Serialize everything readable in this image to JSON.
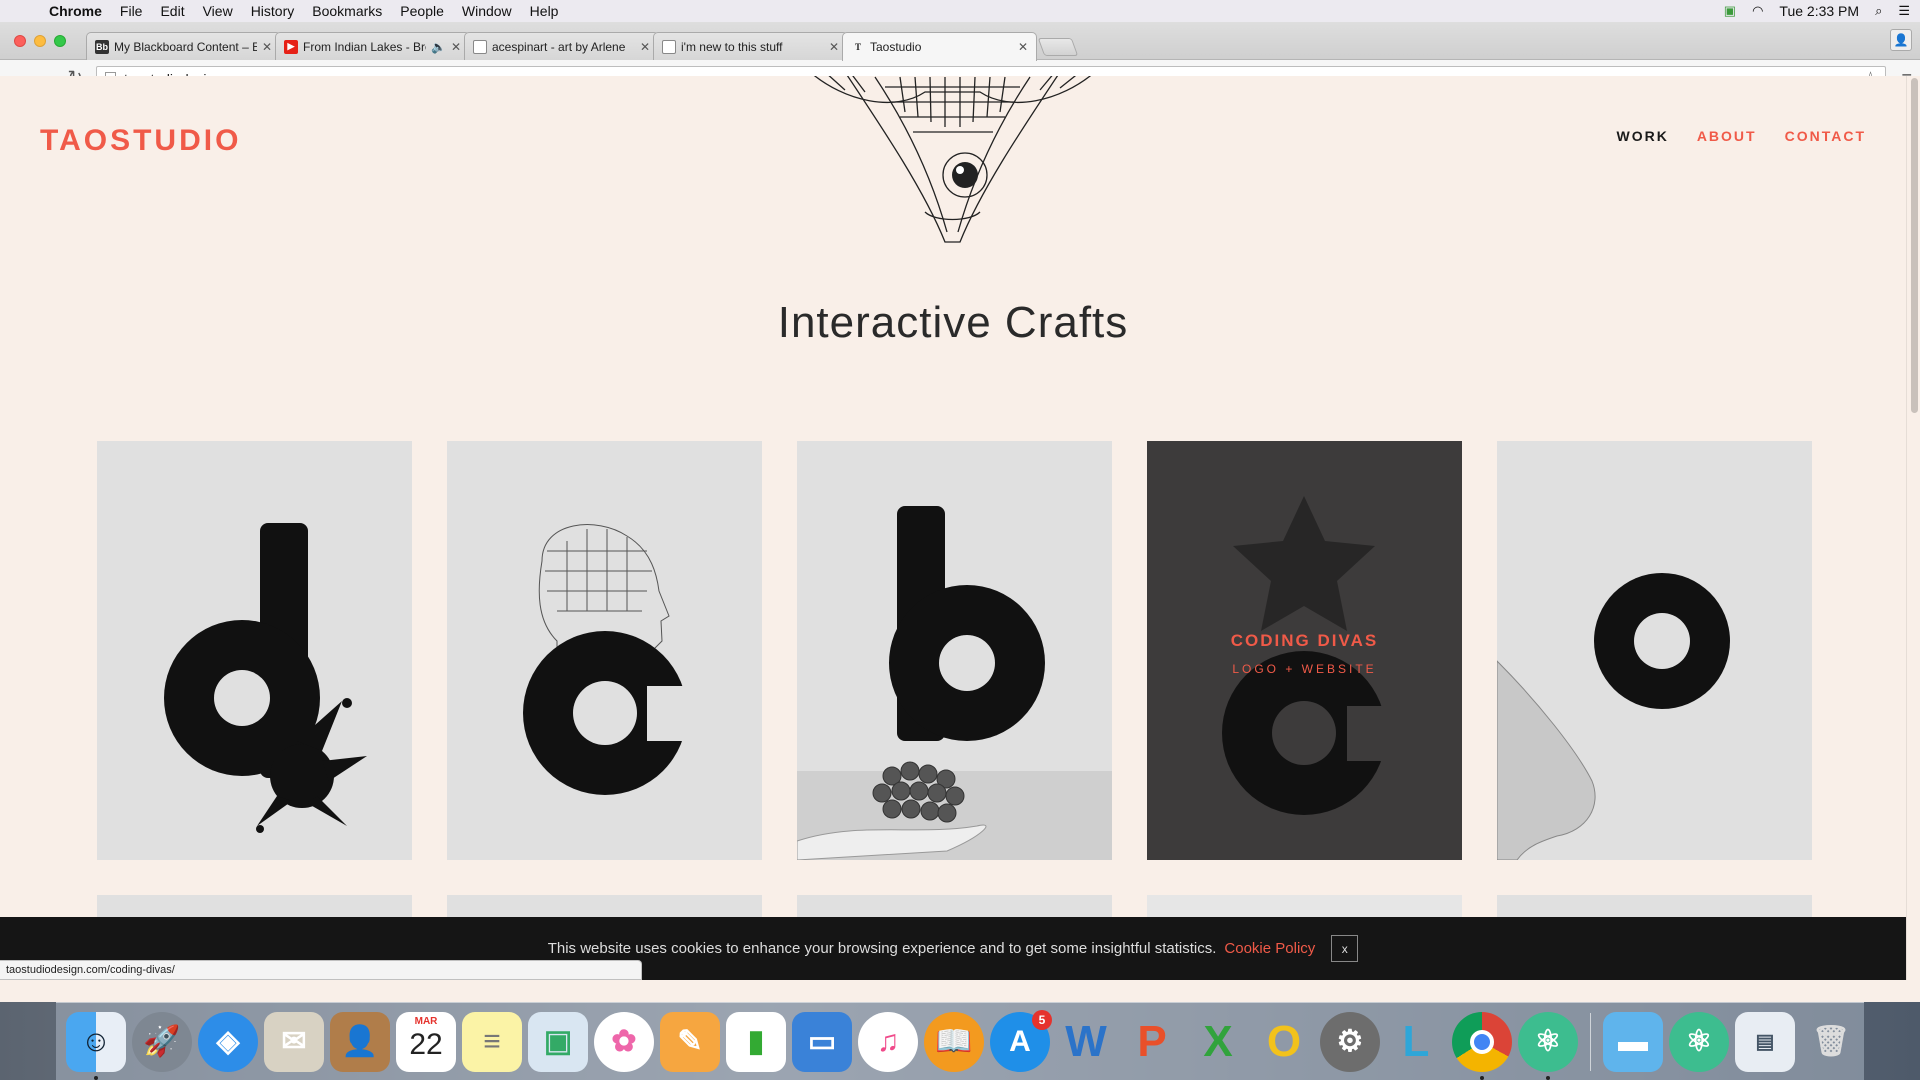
{
  "menubar": {
    "app_name": "Chrome",
    "items": [
      "File",
      "Edit",
      "View",
      "History",
      "Bookmarks",
      "People",
      "Window",
      "Help"
    ],
    "clock": "Tue 2:33 PM"
  },
  "browser": {
    "tabs": [
      {
        "title": "My Blackboard Content – E",
        "favicon": "Bb"
      },
      {
        "title": "From Indian Lakes - Bre",
        "favicon": "youtube"
      },
      {
        "title": "acespinart - art by Arlene",
        "favicon": "doc"
      },
      {
        "title": "i'm new to this stuff",
        "favicon": "doc"
      },
      {
        "title": "Taostudio",
        "favicon": "T"
      }
    ],
    "url": "taostudiodesign.com",
    "status_url": "taostudiodesign.com/coding-divas/"
  },
  "site": {
    "logo": "TAOSTUDIO",
    "nav": {
      "work": "WORK",
      "about": "ABOUT",
      "contact": "CONTACT"
    },
    "section_title": "Interactive Crafts",
    "featured_card": {
      "title": "CODING DIVAS",
      "subtitle": "LOGO + WEBSITE"
    },
    "cards": [
      "d",
      "c",
      "b",
      "c",
      "o"
    ]
  },
  "cookie_banner": {
    "text": "This website uses cookies to enhance your browsing experience and to get some insightful statistics.",
    "policy_link": "Cookie Policy",
    "close": "x"
  },
  "dock": {
    "calendar_month": "MAR",
    "calendar_day": "22",
    "app_store_badge": "5",
    "apps": [
      "finder",
      "launchpad",
      "safari",
      "mail",
      "contacts",
      "calendar",
      "notes",
      "preview",
      "photos",
      "pages",
      "numbers",
      "keynote",
      "itunes",
      "ibooks",
      "app-store",
      "word",
      "powerpoint",
      "excel",
      "outlook",
      "system-preferences",
      "lync",
      "chrome",
      "atom",
      "folder",
      "atom-2",
      "screenshot",
      "trash"
    ]
  }
}
